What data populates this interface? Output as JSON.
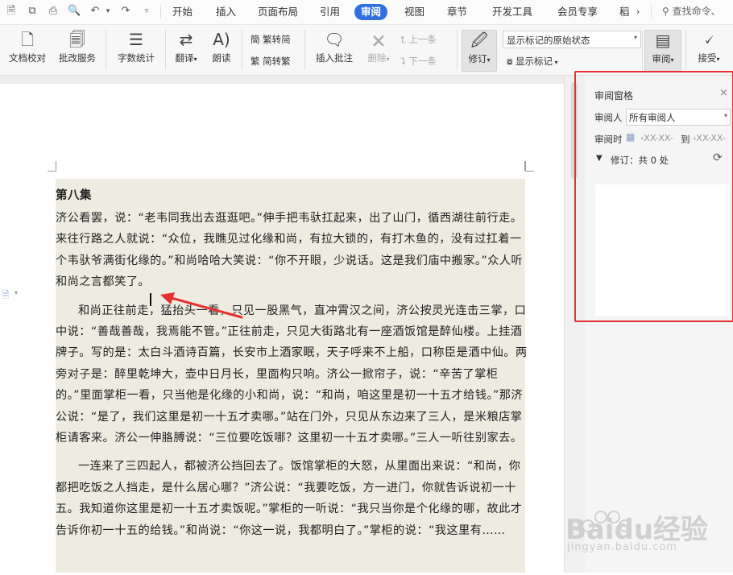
{
  "menubar": {
    "tabs": [
      "开始",
      "插入",
      "页面布局",
      "引用",
      "审阅",
      "视图",
      "章节",
      "开发工具",
      "会员专享",
      "稻"
    ],
    "active_tab": "审阅",
    "search_label": "查找命令、"
  },
  "ribbon": {
    "doc_check": "文档校对",
    "batch_service": "批改服务",
    "word_count": "字数统计",
    "translate": "翻译",
    "read_aloud": "朗读",
    "trad_to_simp": "繁转简",
    "simp_to_trad": "简转繁",
    "insert_comment": "插入批注",
    "delete": "删除",
    "prev": "上一条",
    "next": "下一条",
    "track_changes": "修订",
    "display_state": "显示标记的原始状态",
    "show_markup": "显示标记",
    "review": "审阅",
    "accept": "接受"
  },
  "review_pane": {
    "title": "审阅窗格",
    "reviewer_label": "审阅人",
    "reviewer_value": "所有审阅人",
    "time_label": "审阅时",
    "date_from": "XX-XX-",
    "to_label": "到",
    "date_to": "XX-XX-",
    "revisions_summary": "修订：共 0 处"
  },
  "document": {
    "heading": "第八集",
    "paragraphs": [
      "济公看罢，说：“老韦同我出去逛逛吧。”伸手把韦驮扛起来，出了山门，循西湖往前行走。来往行路之人就说：“众位，我瞧见过化缘和尚，有拉大锁的，有打木鱼的，没有过扛着一个韦驮爷满街化缘的。”和尚哈哈大笑说：“你不开眼，少说话。这是我们庙中搬家。”众人听和尚之言都笑了。",
      "和尚正往前走，猛抬头一看，只见一股黑气，直冲霄汉之间，济公按灵光连击三掌，口中说：“善哉善哉，我焉能不管。”正往前走，只见大街路北有一座酒饭馆是醉仙楼。上挂酒牌子。写的是：太白斗酒诗百篇，长安市上酒家眠，天子呼来不上船，口称臣是酒中仙。两旁对子是：醉里乾坤大，壶中日月长，里面构只响。济公一掀帘子，说：“辛苦了掌柜的。”里面掌柜一看，只当他是化缘的小和尚，说：“和尚，咱这里是初一十五才给钱。”那济公说：“是了，我们这里是初一十五才卖哪。”站在门外，只见从东边来了三人，是米粮店掌柜请客来。济公一伸胳膊说：“三位要吃饭哪？这里初一十五才卖哪。”三人一听往别家去。",
      "一连来了三四起人，都被济公挡回去了。饭馆掌柜的大怒，从里面出来说：“和尚，你都把吃饭之人挡走，是什么居心哪？”济公说：“我要吃饭，方一进门，你就告诉说初一十五。我知道你这里是初一十五才卖饭呢。”掌柜的一听说：“我只当你是个化缘的哪，故此才告诉你初一十五的给钱。”和尚说：“你这一说，我都明白了。”掌柜的说：“我这里有……"
    ]
  },
  "watermark": {
    "brand": "Baidu经验",
    "url": "jingyan.baidu.com"
  }
}
